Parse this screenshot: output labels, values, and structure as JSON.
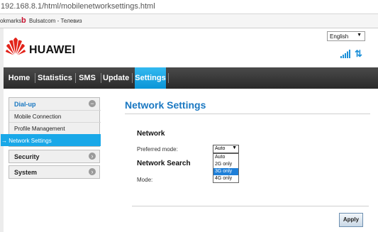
{
  "browser": {
    "url": "192.168.8.1/html/mobilenetworksettings.html",
    "bookmarks_label": "okmarks",
    "bookmark_item": "Bulsatcom - Телевиз"
  },
  "header": {
    "brand": "HUAWEI",
    "language": "English"
  },
  "nav": [
    "Home",
    "Statistics",
    "SMS",
    "Update",
    "Settings"
  ],
  "sidebar": {
    "dialup": {
      "title": "Dial-up",
      "items": [
        "Mobile Connection",
        "Profile Management",
        "→ Network Settings"
      ]
    },
    "security": "Security",
    "system": "System"
  },
  "main": {
    "title": "Network Settings",
    "network_heading": "Network",
    "preferred_mode_label": "Preferred mode:",
    "preferred_mode_value": "Auto",
    "preferred_mode_options": [
      "Auto",
      "2G only",
      "3G only",
      "4G only"
    ],
    "search_heading": "Network Search",
    "mode_label": "Mode:",
    "apply_label": "Apply"
  },
  "colors": {
    "accent": "#19a8e8",
    "title_blue": "#1a78c2",
    "brand_red": "#e2231a",
    "nav_dark": "#333333"
  }
}
